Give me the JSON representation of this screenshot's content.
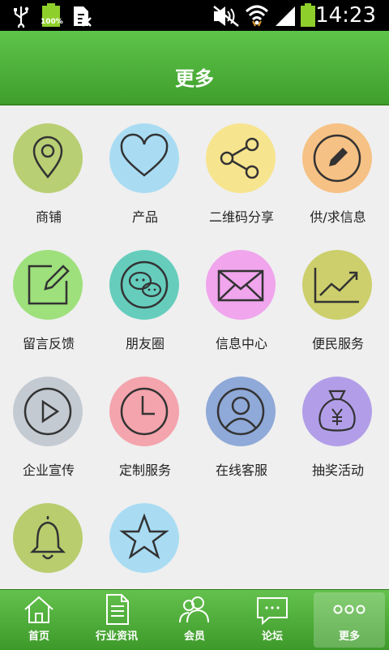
{
  "status_bar": {
    "time": "14:23",
    "battery_percent_label": "100%",
    "icons": [
      "usb-icon",
      "battery-full-icon",
      "sim-card-icon",
      "mute-icon",
      "wifi-icon",
      "signal-icon",
      "battery-icon"
    ]
  },
  "header": {
    "title": "更多"
  },
  "grid": {
    "items": [
      {
        "label": "商铺",
        "icon": "location-pin-icon",
        "color": "#b8cf73"
      },
      {
        "label": "产品",
        "icon": "heart-icon",
        "color": "#a9dcf3"
      },
      {
        "label": "二维码分享",
        "icon": "share-icon",
        "color": "#f7e48e"
      },
      {
        "label": "供/求信息",
        "icon": "pencil-icon",
        "color": "#f6c184"
      },
      {
        "label": "留言反馈",
        "icon": "edit-icon",
        "color": "#9ee07c"
      },
      {
        "label": "朋友圈",
        "icon": "wechat-icon",
        "color": "#66cdbd"
      },
      {
        "label": "信息中心",
        "icon": "mail-icon",
        "color": "#f0a5ec"
      },
      {
        "label": "便民服务",
        "icon": "trend-chart-icon",
        "color": "#cccf6b"
      },
      {
        "label": "企业宣传",
        "icon": "play-icon",
        "color": "#c3cad2"
      },
      {
        "label": "定制服务",
        "icon": "clock-icon",
        "color": "#f4a4ad"
      },
      {
        "label": "在线客服",
        "icon": "user-circle-icon",
        "color": "#8fa9d8"
      },
      {
        "label": "抽奖活动",
        "icon": "money-bag-icon",
        "color": "#b29ee8"
      },
      {
        "label": "",
        "icon": "bell-icon",
        "color": "#b9cd6e"
      },
      {
        "label": "",
        "icon": "star-icon",
        "color": "#a9dcf3"
      }
    ]
  },
  "bottom_nav": {
    "items": [
      {
        "label": "首页",
        "icon": "home-icon"
      },
      {
        "label": "行业资讯",
        "icon": "document-icon"
      },
      {
        "label": "会员",
        "icon": "members-icon"
      },
      {
        "label": "论坛",
        "icon": "chat-bubble-icon"
      },
      {
        "label": "更多",
        "icon": "more-dots-icon",
        "active": true
      }
    ]
  }
}
